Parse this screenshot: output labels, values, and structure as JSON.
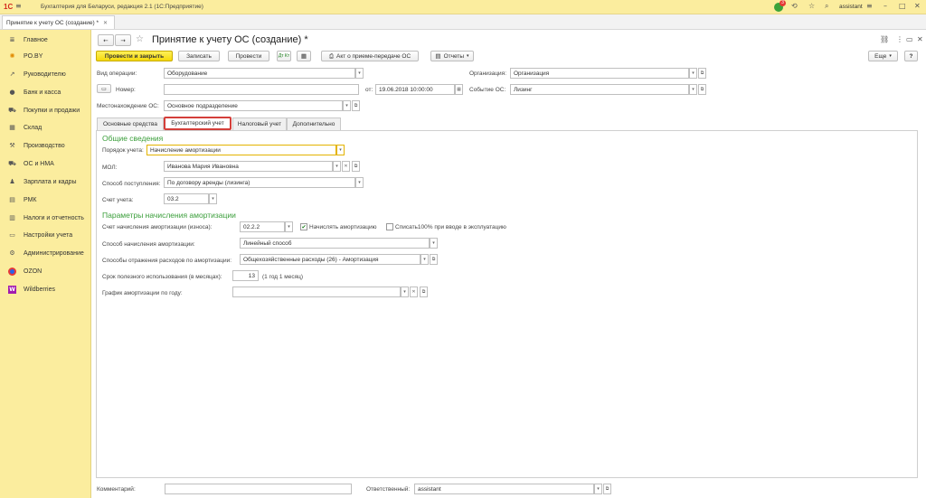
{
  "app": {
    "window_title": "Бухгалтерия для Беларуси, редакция 2.1  (1С:Предприятие)",
    "user": "assistant",
    "badge_count": "3"
  },
  "doc_tab": {
    "label": "Принятие к учету ОС (создание) *"
  },
  "sidebar": {
    "items": [
      {
        "label": "Главное"
      },
      {
        "label": "PO.BY"
      },
      {
        "label": "Руководителю"
      },
      {
        "label": "Банк и касса"
      },
      {
        "label": "Покупки и продажи"
      },
      {
        "label": "Склад"
      },
      {
        "label": "Производство"
      },
      {
        "label": "ОС и НМА"
      },
      {
        "label": "Зарплата и кадры"
      },
      {
        "label": "РМК"
      },
      {
        "label": "Налоги и отчетность"
      },
      {
        "label": "Настройки учета"
      },
      {
        "label": "Администрирование"
      },
      {
        "label": "OZON"
      },
      {
        "label": "Wildberries"
      }
    ]
  },
  "form": {
    "title": "Принятие к учету ОС (создание) *",
    "toolbar": {
      "post_close": "Провести и закрыть",
      "save": "Записать",
      "post": "Провести",
      "dt_kt": "Дт Кт",
      "act": "Акт о приеме-передаче ОС",
      "reports": "Отчеты",
      "more": "Еще",
      "help": "?"
    },
    "header": {
      "op_type_label": "Вид операции:",
      "op_type_value": "Оборудование",
      "org_label": "Организация:",
      "org_value": "Организация",
      "number_label": "Номер:",
      "number_value": "",
      "date_label": "от:",
      "date_value": "19.06.2018 10:00:00",
      "event_label": "Событие ОС:",
      "event_value": "Лизинг",
      "location_label": "Местонахождение ОС:",
      "location_value": "Основное подразделение"
    },
    "tabs": [
      {
        "label": "Основные средства"
      },
      {
        "label": "Бухгалтерский учет"
      },
      {
        "label": "Налоговый учет"
      },
      {
        "label": "Дополнительно"
      }
    ],
    "general": {
      "section_title": "Общие сведения",
      "order_label": "Порядок учета:",
      "order_value": "Начисление амортизации",
      "mol_label": "МОЛ:",
      "mol_value": "Иванова Мария Ивановна",
      "receipt_label": "Способ поступления:",
      "receipt_value": "По договору аренды (лизинга)",
      "account_label": "Счет учета:",
      "account_value": "03.2"
    },
    "amort": {
      "section_title": "Параметры начисления амортизации",
      "acc_label": "Счет начисления амортизации (износа):",
      "acc_value": "02.2.2",
      "charge_label": "Начислять амортизацию",
      "charge_checked": true,
      "writeoff_label": "Списать100% при вводе в эксплуатацию",
      "writeoff_checked": false,
      "method_label": "Способ начисления амортизации:",
      "method_value": "Линейный способ",
      "expense_label": "Способы отражения расходов по амортизации:",
      "expense_value": "Общехозяйственные расходы (26) - Амортизация",
      "term_label": "Срок полезного использования (в месяцах):",
      "term_value": "13",
      "term_note": "(1 год 1 месяц)",
      "schedule_label": "График амортизации по году:",
      "schedule_value": ""
    },
    "footer": {
      "comment_label": "Комментарий:",
      "comment_value": "",
      "resp_label": "Ответственный:",
      "resp_value": "assistant"
    }
  }
}
